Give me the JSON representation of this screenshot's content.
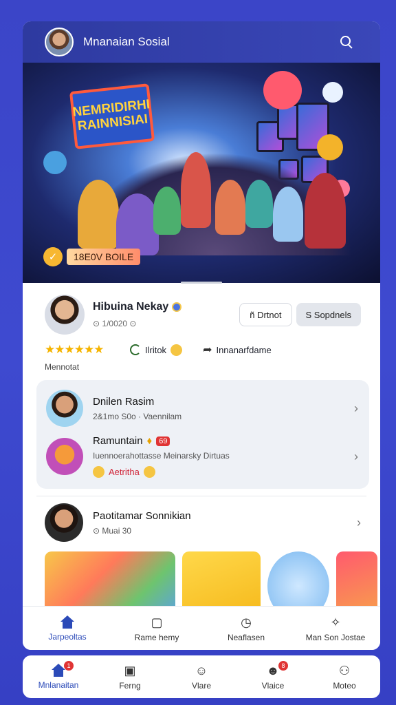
{
  "app": {
    "title": "Mnanaian Sosial"
  },
  "hero": {
    "sign_lines": [
      "NEMRIDIRHI",
      "RAINNISIAI"
    ],
    "badge_icon": "✓",
    "badge_text": "18E0V BOILE"
  },
  "profile": {
    "name": "Hibuina Nekay",
    "sub": "⊙ 1/0020 ⊙",
    "btn_outline": "ñ Drtnot",
    "btn_fill": "S Sopdnels",
    "stars": "★★★★★★",
    "action1": "Ilritok",
    "action2": "Innanarfdame",
    "caption": "Mennotat"
  },
  "list": [
    {
      "title": "Dnilen Rasim",
      "sub": "2&1mo S0o · Vaennilam"
    },
    {
      "title": "Ramuntain",
      "tag": "69",
      "sub": "Iuennoerahottasse Meinarsky Dirtuas",
      "extra": "Aetritha"
    }
  ],
  "single": {
    "title": "Paotitamar Sonnikian",
    "sub": "⊙ Muai 30"
  },
  "inner_nav": [
    {
      "label": "Jarpeoltas",
      "glyph": "home"
    },
    {
      "label": "Rame hemy",
      "glyph": "▢"
    },
    {
      "label": "Neaflasen",
      "glyph": "◷"
    },
    {
      "label": "Man Son Jostae",
      "glyph": "✧"
    }
  ],
  "bottom_nav": [
    {
      "label": "Mnlanaitan",
      "badge": "1"
    },
    {
      "label": "Ferng",
      "badge": ""
    },
    {
      "label": "Vlare",
      "badge": ""
    },
    {
      "label": "Vlaice",
      "badge": "8"
    },
    {
      "label": "Moteo",
      "badge": ""
    }
  ],
  "colors": {
    "accent": "#2b4ab8",
    "background": "#3b45c8",
    "header": "#2e3aa0"
  }
}
